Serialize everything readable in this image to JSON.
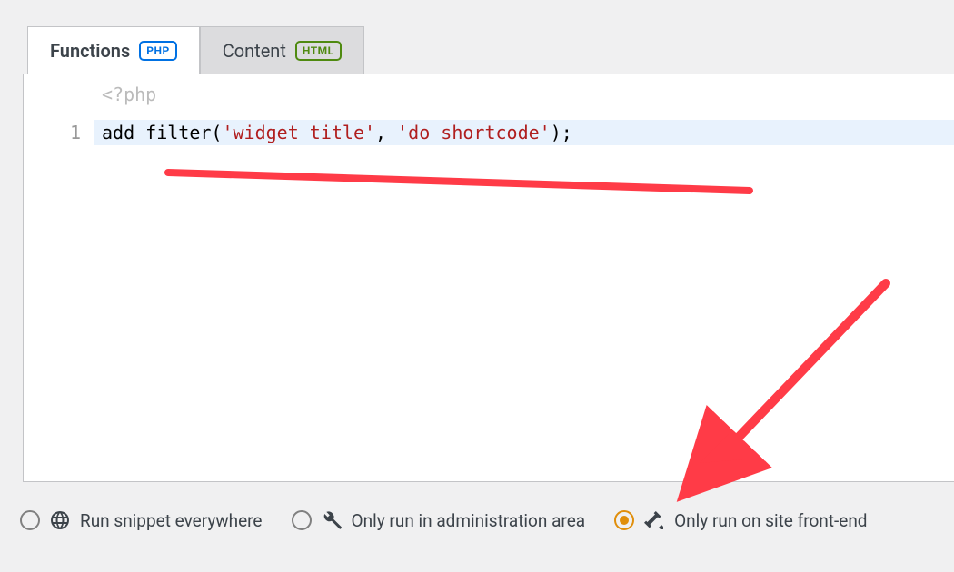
{
  "tabs": {
    "functions": {
      "label": "Functions",
      "badge": "PHP"
    },
    "content": {
      "label": "Content",
      "badge": "HTML"
    }
  },
  "editor": {
    "prelude": "<?php",
    "gutter_first": "1",
    "tokens": {
      "fn": "add_filter",
      "open": "(",
      "arg1": "'widget_title'",
      "comma": ", ",
      "arg2": "'do_shortcode'",
      "close": ");"
    }
  },
  "scope": {
    "everywhere": "Run snippet everywhere",
    "admin": "Only run in administration area",
    "front": "Only run on site front-end",
    "selected": "front"
  }
}
